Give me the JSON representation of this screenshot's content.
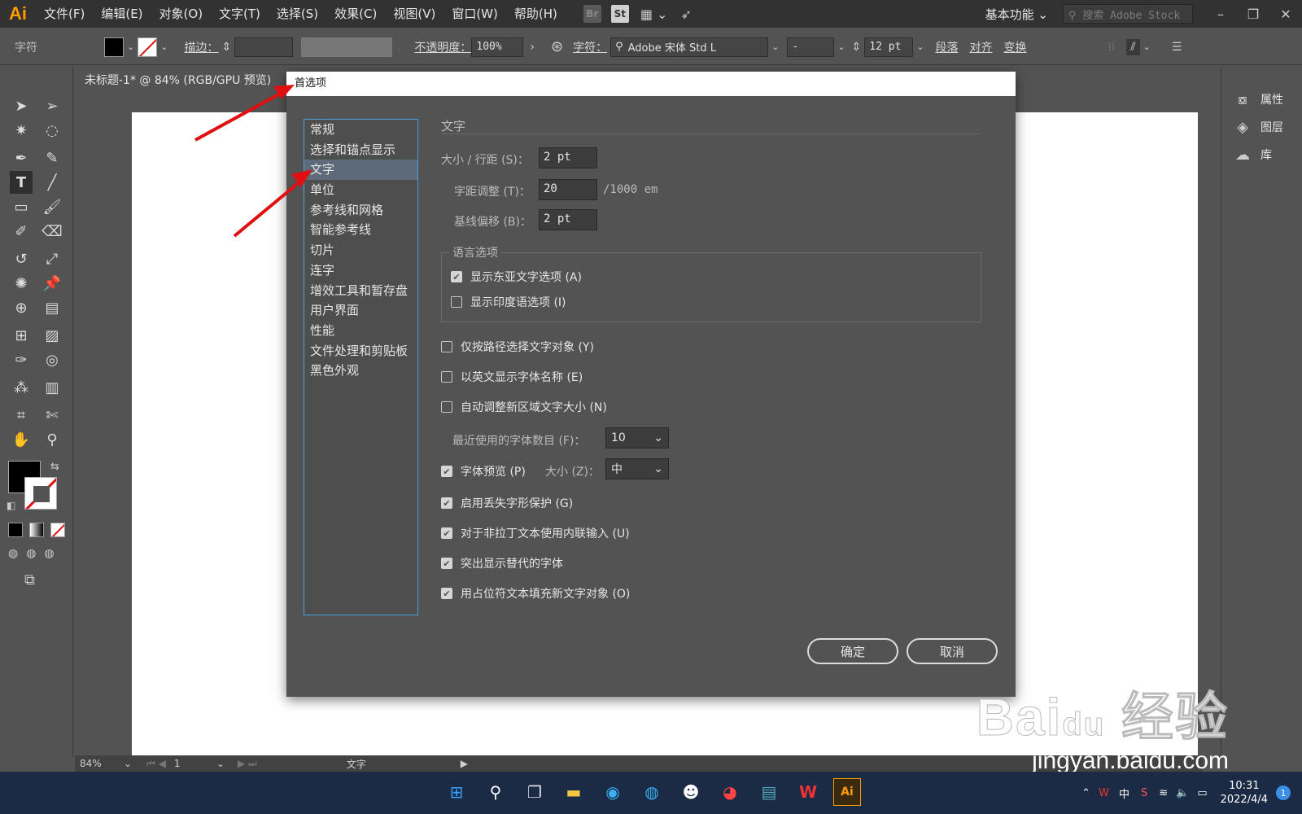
{
  "app": {
    "logo": "Ai",
    "menus": [
      "文件(F)",
      "编辑(E)",
      "对象(O)",
      "文字(T)",
      "选择(S)",
      "效果(C)",
      "视图(V)",
      "窗口(W)",
      "帮助(H)"
    ],
    "bridge_label": "Br",
    "stock_label": "St",
    "workspace": "基本功能",
    "stock_search_placeholder": "搜索 Adobe Stock"
  },
  "controlbar": {
    "panel_label": "字符",
    "stroke_label": "描边：",
    "opacity_label": "不透明度：",
    "opacity_value": "100%",
    "char_label": "字符：",
    "font_name": "Adobe 宋体 Std L",
    "font_style": "-",
    "font_size": "12 pt",
    "paragraph_label": "段落",
    "align_label": "对齐",
    "transform_label": "变换"
  },
  "document": {
    "tab_title": "未标题-1* @ 84% (RGB/GPU 预览)"
  },
  "right_panel": {
    "items": [
      "属性",
      "图层",
      "库"
    ]
  },
  "statusbar": {
    "zoom": "84%",
    "artboard": "1",
    "tool": "文字"
  },
  "dialog": {
    "title": "首选项",
    "nav": [
      "常规",
      "选择和锚点显示",
      "文字",
      "单位",
      "参考线和网格",
      "智能参考线",
      "切片",
      "连字",
      "增效工具和暂存盘",
      "用户界面",
      "性能",
      "文件处理和剪贴板",
      "黑色外观"
    ],
    "selected_nav": "文字",
    "section_title": "文字",
    "size_leading_label": "大小 / 行距 (S)：",
    "size_leading_value": "2 pt",
    "tracking_label": "字距调整 (T)：",
    "tracking_value": "20",
    "tracking_unit": "/1000 em",
    "baseline_label": "基线偏移 (B)：",
    "baseline_value": "2 pt",
    "language_group": "语言选项",
    "show_east_asian": "显示东亚文字选项 (A)",
    "show_indic": "显示印度语选项 (I)",
    "select_by_path": "仅按路径选择文字对象 (Y)",
    "english_font_names": "以英文显示字体名称 (E)",
    "auto_size_area": "自动调整新区域文字大小 (N)",
    "recent_fonts_label": "最近使用的字体数目 (F)：",
    "recent_fonts_value": "10",
    "font_preview": "字体预览 (P)",
    "preview_size_label": "大小 (Z)：",
    "preview_size_value": "中",
    "missing_glyph": "启用丢失字形保护 (G)",
    "inline_input": "对于非拉丁文本使用内联输入 (U)",
    "highlight_substituted": "突出显示替代的字体",
    "fill_placeholder": "用占位符文本填充新文字对象 (O)",
    "ok_label": "确定",
    "cancel_label": "取消"
  },
  "checks": {
    "show_east_asian": true,
    "show_indic": false,
    "select_by_path": false,
    "english_font_names": false,
    "auto_size_area": false,
    "font_preview": true,
    "missing_glyph": true,
    "inline_input": true,
    "highlight_substituted": true,
    "fill_placeholder": true
  },
  "taskbar": {
    "ime": "中",
    "time": "10:31",
    "date": "2022/4/4",
    "notifications": "1"
  },
  "watermark": {
    "logo": "Bai du 经验",
    "url": "jingyan.baidu.com"
  },
  "colors": {
    "ai_orange": "#ff9a00",
    "arrow_red": "#e01010",
    "selection": "#5d6a7a",
    "focus_blue": "#4aa1e0"
  }
}
